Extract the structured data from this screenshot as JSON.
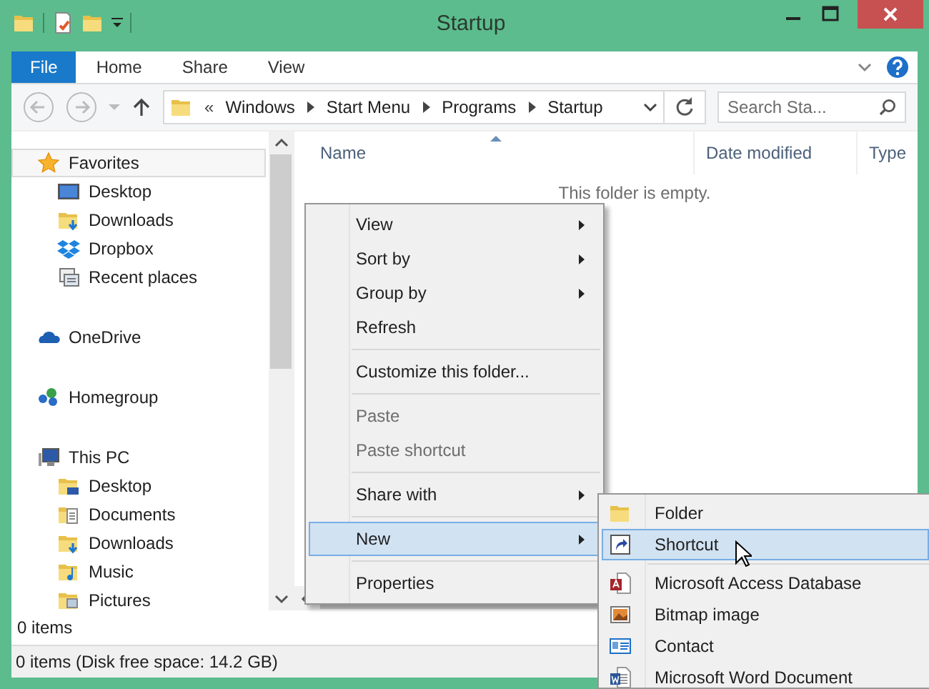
{
  "window": {
    "title": "Startup"
  },
  "ribbon": {
    "tabs": [
      {
        "label": "File",
        "kind": "file",
        "selected": false
      },
      {
        "label": "Home",
        "kind": "tab",
        "selected": false
      },
      {
        "label": "Share",
        "kind": "tab",
        "selected": false
      },
      {
        "label": "View",
        "kind": "tab",
        "selected": false
      }
    ]
  },
  "address": {
    "overflow": "«",
    "breadcrumbs": [
      "Windows",
      "Start Menu",
      "Programs",
      "Startup"
    ],
    "search": {
      "placeholder": "Search Sta..."
    }
  },
  "sidebar": {
    "items": [
      {
        "label": "Favorites",
        "kind": "star",
        "selected": true,
        "children": [
          {
            "label": "Desktop",
            "kind": "desktop",
            "selected": false
          },
          {
            "label": "Downloads",
            "kind": "downloads",
            "selected": false
          },
          {
            "label": "Dropbox",
            "kind": "dropbox",
            "selected": false
          },
          {
            "label": "Recent places",
            "kind": "recent",
            "selected": false
          }
        ]
      },
      {
        "label": "OneDrive",
        "kind": "cloud",
        "selected": false
      },
      {
        "label": "Homegroup",
        "kind": "homegroup",
        "selected": false
      },
      {
        "label": "This PC",
        "kind": "pc",
        "selected": false,
        "children": [
          {
            "label": "Desktop",
            "kind": "desktop-folder",
            "selected": false
          },
          {
            "label": "Documents",
            "kind": "documents",
            "selected": false
          },
          {
            "label": "Downloads",
            "kind": "downloads",
            "selected": false
          },
          {
            "label": "Music",
            "kind": "music",
            "selected": false
          },
          {
            "label": "Pictures",
            "kind": "pictures",
            "selected": false
          }
        ]
      }
    ]
  },
  "file_list": {
    "columns": [
      {
        "label": "Name",
        "sorted": true
      },
      {
        "label": "Date modified",
        "sorted": false
      },
      {
        "label": "Type",
        "sorted": false
      }
    ],
    "empty_message": "This folder is empty."
  },
  "pane_status": "0 items",
  "status_bar": "0 items (Disk free space: 14.2 GB)",
  "context_menu": {
    "items": [
      {
        "kind": "item",
        "label": "View",
        "submenu": true,
        "disabled": false,
        "selected": false
      },
      {
        "kind": "item",
        "label": "Sort by",
        "submenu": true,
        "disabled": false,
        "selected": false
      },
      {
        "kind": "item",
        "label": "Group by",
        "submenu": true,
        "disabled": false,
        "selected": false
      },
      {
        "kind": "item",
        "label": "Refresh",
        "submenu": false,
        "disabled": false,
        "selected": false
      },
      {
        "kind": "separator"
      },
      {
        "kind": "item",
        "label": "Customize this folder...",
        "submenu": false,
        "disabled": false,
        "selected": false
      },
      {
        "kind": "separator"
      },
      {
        "kind": "item",
        "label": "Paste",
        "submenu": false,
        "disabled": true,
        "selected": false
      },
      {
        "kind": "item",
        "label": "Paste shortcut",
        "submenu": false,
        "disabled": true,
        "selected": false
      },
      {
        "kind": "separator"
      },
      {
        "kind": "item",
        "label": "Share with",
        "submenu": true,
        "disabled": false,
        "selected": false
      },
      {
        "kind": "separator"
      },
      {
        "kind": "item",
        "label": "New",
        "submenu": true,
        "disabled": false,
        "selected": true
      },
      {
        "kind": "separator"
      },
      {
        "kind": "item",
        "label": "Properties",
        "submenu": false,
        "disabled": false,
        "selected": false
      }
    ]
  },
  "new_submenu": {
    "items": [
      {
        "kind": "folder",
        "label": "Folder",
        "selected": false
      },
      {
        "kind": "shortcut",
        "label": "Shortcut",
        "selected": true
      },
      {
        "kind": "separator"
      },
      {
        "kind": "access",
        "label": "Microsoft Access Database",
        "selected": false
      },
      {
        "kind": "bitmap",
        "label": "Bitmap image",
        "selected": false
      },
      {
        "kind": "contact",
        "label": "Contact",
        "selected": false
      },
      {
        "kind": "word",
        "label": "Microsoft Word Document",
        "selected": false
      }
    ]
  }
}
